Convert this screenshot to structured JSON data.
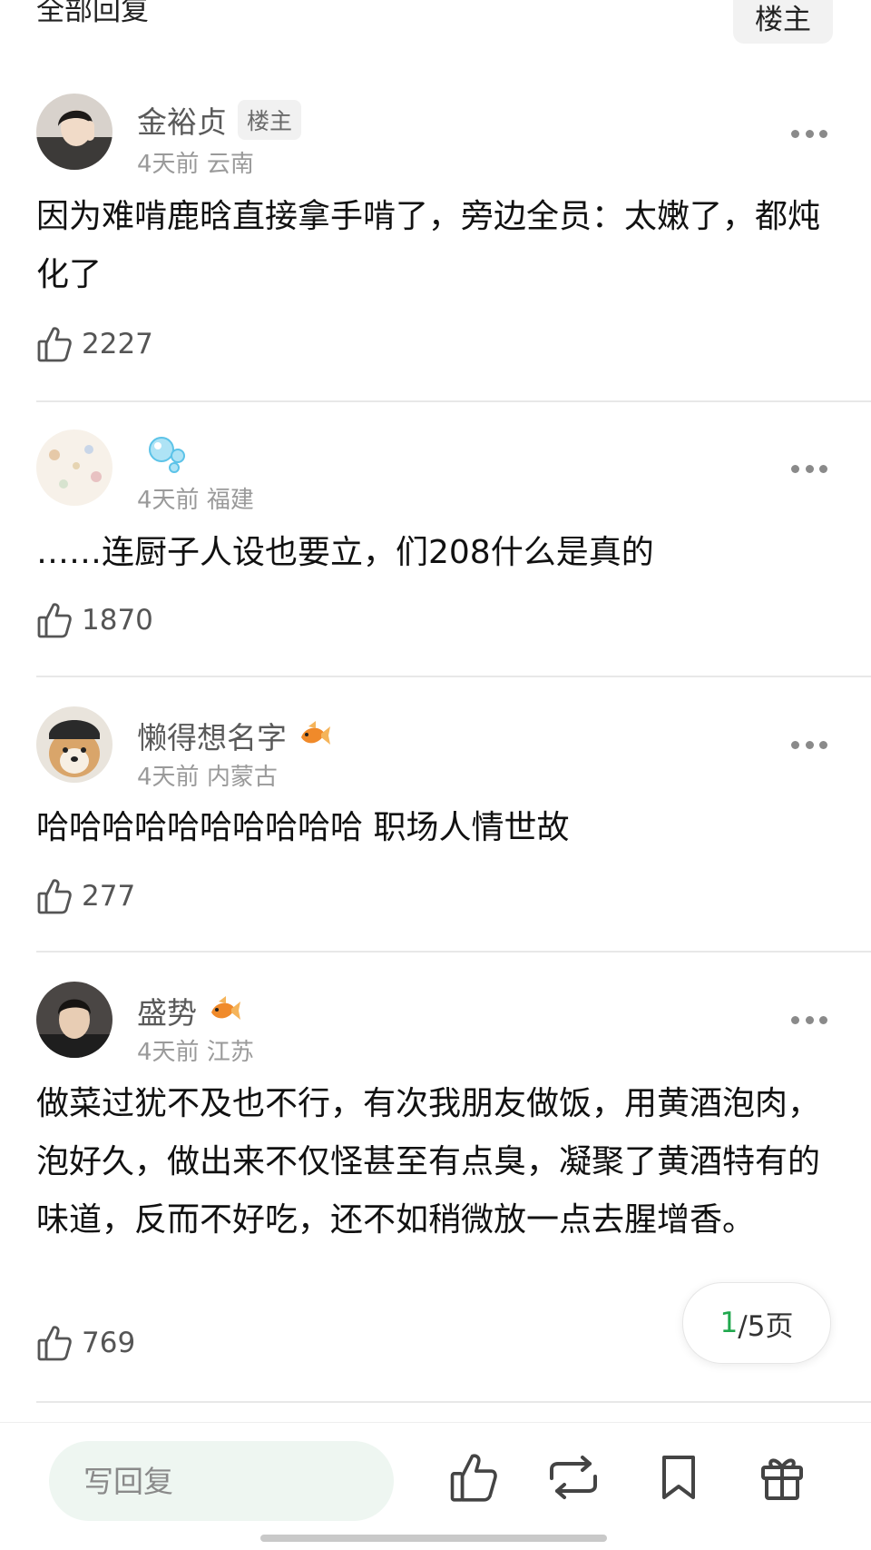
{
  "header": {
    "title": "全部回复",
    "op_filter_label": "楼主"
  },
  "comments": [
    {
      "username": "金裕贞",
      "op_tag": "楼主",
      "time": "4天前",
      "location": "云南",
      "text": "因为难啃鹿晗直接拿手啃了，旁边全员：太嫩了，都炖化了",
      "likes": "2227",
      "badge": ""
    },
    {
      "username": "",
      "time": "4天前",
      "location": "福建",
      "text": "……连厨子人设也要立，们208什么是真的",
      "likes": "1870",
      "badge": "bubbles-icon"
    },
    {
      "username": "懒得想名字",
      "time": "4天前",
      "location": "内蒙古",
      "text": "哈哈哈哈哈哈哈哈哈哈 职场人情世故",
      "likes": "277",
      "badge": "goldfish-icon"
    },
    {
      "username": "盛势",
      "time": "4天前",
      "location": "江苏",
      "text": "做菜过犹不及也不行，有次我朋友做饭，用黄酒泡肉，泡好久，做出来不仅怪甚至有点臭，凝聚了黄酒特有的味道，反而不好吃，还不如稍微放一点去腥增香。",
      "likes": "769",
      "badge": "goldfish-icon"
    }
  ],
  "pager": {
    "current": "1",
    "rest": "/5页"
  },
  "bottom_bar": {
    "reply_placeholder": "写回复",
    "icons": [
      "thumbs-up-icon",
      "repost-icon",
      "bookmark-icon",
      "gift-icon"
    ]
  },
  "colors": {
    "accent_green": "#21a84e",
    "input_bg": "#eef6f1",
    "divider": "#e8e8e8"
  }
}
